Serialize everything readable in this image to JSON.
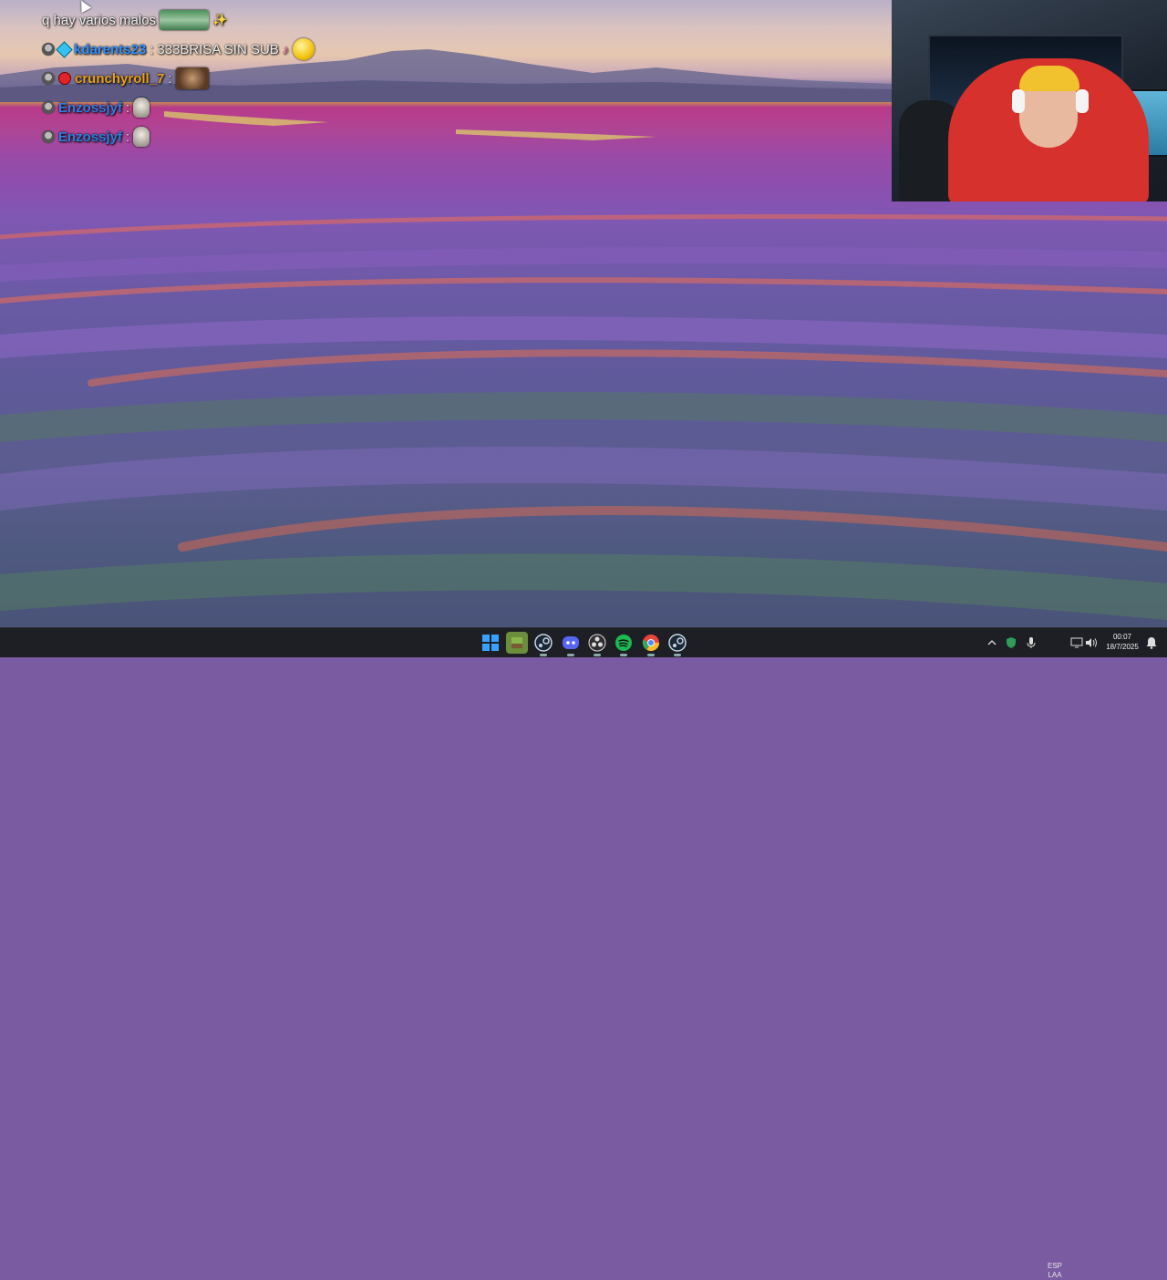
{
  "chat": {
    "messages": [
      {
        "user": "",
        "text": "q hay varios malos",
        "emote": "frog-emote",
        "extra": "✨",
        "user_color": "#ffffff"
      },
      {
        "user": "kdarents23",
        "separator": ":",
        "text": "333BRISA SIN SUB",
        "emote": "smile-emote",
        "extra": "♪",
        "user_color": "#2e8fff",
        "badges": [
          "mod",
          "gem"
        ]
      },
      {
        "user": "crunchyroll_7",
        "separator": ":",
        "text": "",
        "emote": "cat-emote",
        "user_color": "#e8a020",
        "badges": [
          "mod",
          "red"
        ]
      },
      {
        "user": "Enzossjyf",
        "separator": ":",
        "text": "",
        "emote": "skull-emote",
        "user_color": "#2e7fe0",
        "badges": [
          "mod"
        ]
      },
      {
        "user": "Enzossjyf",
        "separator": ":",
        "text": "",
        "emote": "skull-emote",
        "user_color": "#2e7fe0",
        "badges": [
          "mod"
        ]
      }
    ]
  },
  "taskbar": {
    "apps": [
      {
        "name": "windows-start-icon",
        "color": "#3aa0ff"
      },
      {
        "name": "minecraft-icon",
        "color": "#6b8e3a"
      },
      {
        "name": "steam-icon",
        "color": "#1b2838"
      },
      {
        "name": "discord-icon",
        "color": "#5865f2"
      },
      {
        "name": "obs-icon",
        "color": "#302e31"
      },
      {
        "name": "spotify-icon",
        "color": "#1db954"
      },
      {
        "name": "chrome-icon",
        "color": "#e8453c"
      },
      {
        "name": "steam-icon",
        "color": "#1b2838"
      }
    ],
    "tray": {
      "language_line1": "ESP",
      "language_line2": "LAA",
      "time": "00:07",
      "date": "18/7/2025"
    }
  }
}
